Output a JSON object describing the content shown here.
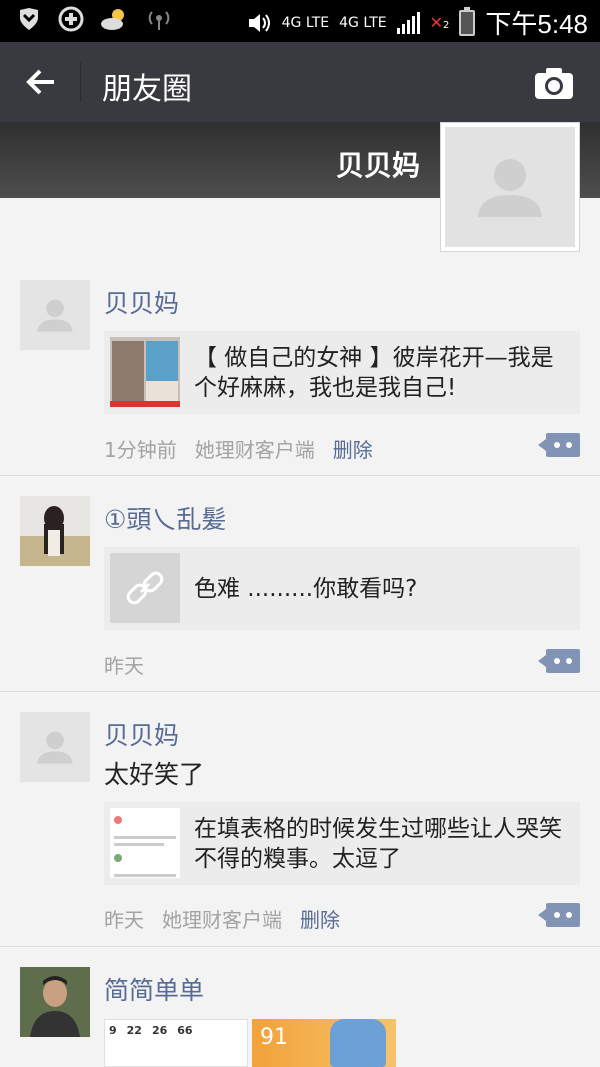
{
  "status_bar": {
    "network_1": "4G LTE",
    "network_2": "4G LTE",
    "sim_2": "2",
    "time": "下午5:48"
  },
  "header": {
    "title": "朋友圈"
  },
  "cover": {
    "owner_name": "贝贝妈"
  },
  "posts": [
    {
      "user": "贝贝妈",
      "link_text": "【 做自己的女神 】彼岸花开—我是个好麻麻，我也是我自己!",
      "time": "1分钟前",
      "source": "她理财客户端",
      "delete": "删除"
    },
    {
      "user": "①頭乀乱髪",
      "link_text": "色难 .........你敢看吗?",
      "time": "昨天"
    },
    {
      "user": "贝贝妈",
      "text": "太好笑了",
      "link_text": "在填表格的时候发生过哪些让人哭笑不得的糗事。太逗了",
      "time": "昨天",
      "source": "她理财客户端",
      "delete": "删除"
    },
    {
      "user": "简简单单",
      "image_1_numbers": [
        "9",
        "22",
        "26",
        "66"
      ],
      "image_2_number": "91"
    }
  ],
  "colors": {
    "title_bar": "#393a3f",
    "username": "#576b95",
    "comment_button": "#8294b5"
  }
}
